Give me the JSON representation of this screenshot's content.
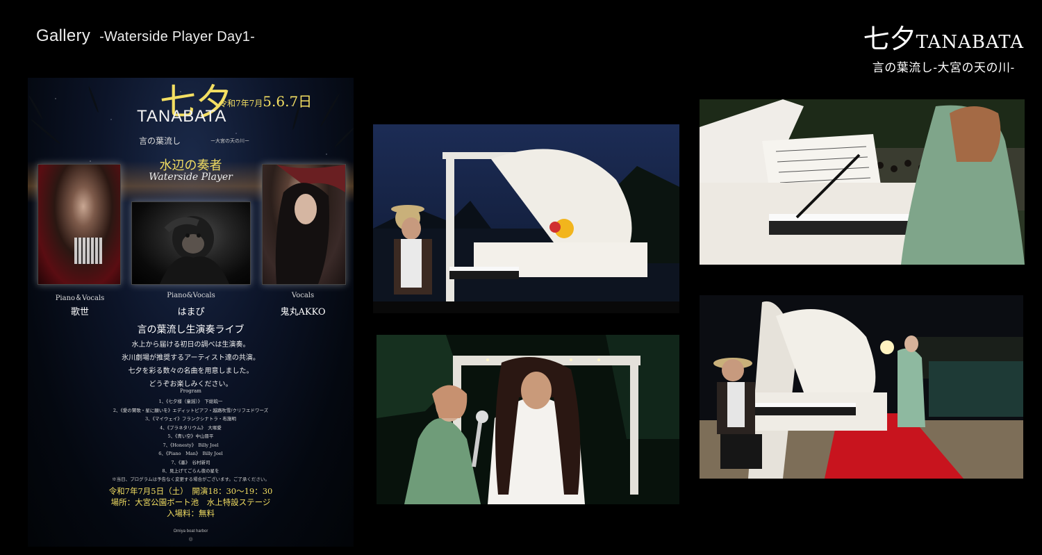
{
  "header": {
    "gallery_label": "Gallery",
    "gallery_subtitle": "-Waterside Player Day1-"
  },
  "brand": {
    "kanji": "七夕",
    "latin": "TANABATA",
    "tagline": "言の葉流し-大宮の天の川-"
  },
  "poster": {
    "date_prefix": "令和7年7月",
    "date_days": "5.6.7日",
    "kanji": "七夕",
    "title_latin": "TANABATA",
    "kotoba": "言の葉流し",
    "river_sub": "ー大宮の天の川ー",
    "jp_title": "水辺の奏者",
    "en_title": "Waterside Player",
    "performers": [
      {
        "role": "Piano＆Vocals",
        "name": "歌世"
      },
      {
        "role": "Piano&Vocals",
        "name": "はまぴ"
      },
      {
        "role": "Vocals",
        "name": "鬼丸AKKO"
      }
    ],
    "live_title": "言の葉流し生演奏ライブ",
    "description": [
      "水上から届ける初日の調べは生演奏。",
      "氷川劇場が推奨するアーティスト達の共演。",
      "七夕を彩る数々の名曲を用意しました。",
      "どうぞお楽しみください。"
    ],
    "program_heading": "Program",
    "program": [
      "1、《七夕様（童謡）》　下総皖一",
      "2、《愛の賛歌・星に願いを》エディットピアフ・越路吹雪/クリフエドワーズ",
      "3、《マイウェイ》フランクシナトラ・布施明",
      "4、《プラネタリウム》　大塚愛",
      "5、《青い空》中山晋平",
      "7、《Honesty》　Billy Joel",
      "6、《Piano　Man》　Billy Joel",
      "7、《墨》　谷村新司",
      "8、見上げてごらん夜の星を"
    ],
    "note": "※当日、プログラムは予告なく変更する場合がございます。ご了承ください。",
    "info": [
      "令和7年7月5日（土）　開演18：30〜19：30",
      "場所：大宮公園ボート池　水上特設ステージ",
      "入場料：無料"
    ],
    "harbor": "Omiya boat harbor"
  },
  "photos": [
    {
      "name": "photo-pianist-night"
    },
    {
      "name": "photo-pianist-audience"
    },
    {
      "name": "photo-duet-singers"
    },
    {
      "name": "photo-stage-performance"
    }
  ]
}
